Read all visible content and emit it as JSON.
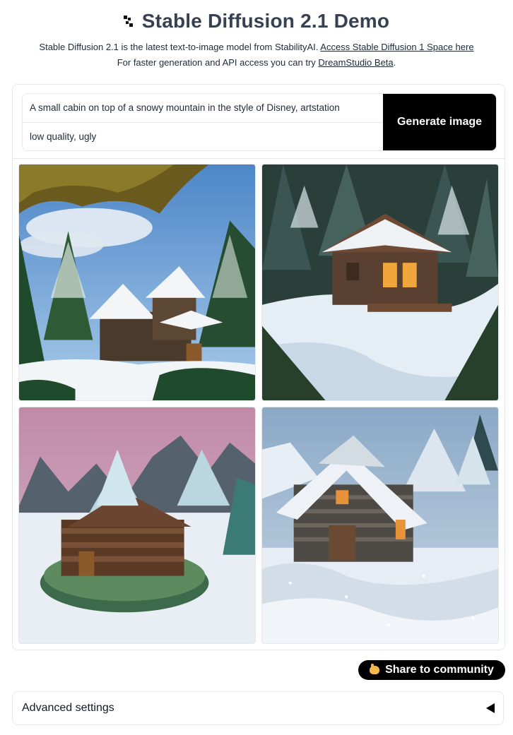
{
  "header": {
    "title": "Stable Diffusion 2.1 Demo",
    "line1_text": "Stable Diffusion 2.1 is the latest text-to-image model from StabilityAI. ",
    "line1_link": "Access Stable Diffusion 1 Space here",
    "line2_text": "For faster generation and API access you can try ",
    "line2_link": "DreamStudio Beta",
    "line2_end": "."
  },
  "prompt": {
    "positive": "A small cabin on top of a snowy mountain in the style of Disney, artstation",
    "negative": "low quality, ugly"
  },
  "buttons": {
    "generate": "Generate image",
    "share": "Share to community"
  },
  "advanced": {
    "label": "Advanced settings"
  },
  "gallery": {
    "images": [
      {
        "icon": "cabin-image-1"
      },
      {
        "icon": "cabin-image-2"
      },
      {
        "icon": "cabin-image-3"
      },
      {
        "icon": "cabin-image-4"
      }
    ]
  },
  "colors": {
    "button_bg": "#000000",
    "border": "#e5e7eb",
    "title": "#374151"
  }
}
